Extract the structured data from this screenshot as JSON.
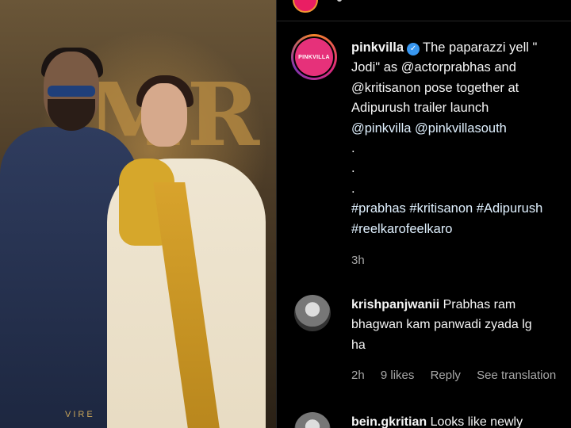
{
  "media": {
    "background_letters": "MR",
    "watermark": "VIRE"
  },
  "post": {
    "username": "pinkvilla",
    "avatar_logo": "PINKVILLA",
    "caption_lines": [
      "The paparazzi yell \"",
      "Jodi\" as @actorprabhas and",
      "@kritisanon pose together at",
      "Adipurush trailer launch",
      "@pinkvilla @pinkvillasouth",
      ".",
      ".",
      ".",
      "#prabhas #kritisanon #Adipurush",
      "#reelkarofeelkaro"
    ],
    "time": "3h"
  },
  "comments": [
    {
      "username": "krishpanjwanii",
      "text_first": "Prabhas ram",
      "lines": [
        "bhagwan kam panwadi zyada lg",
        "ha"
      ],
      "time": "2h",
      "likes": "9 likes",
      "reply": "Reply",
      "translation": "See translation"
    },
    {
      "username": "bein.gkritian",
      "text_first": "Looks like newly"
    }
  ],
  "colors": {
    "verified": "#3897f0",
    "link": "#e0f1ff",
    "muted": "#a8a8a8"
  }
}
